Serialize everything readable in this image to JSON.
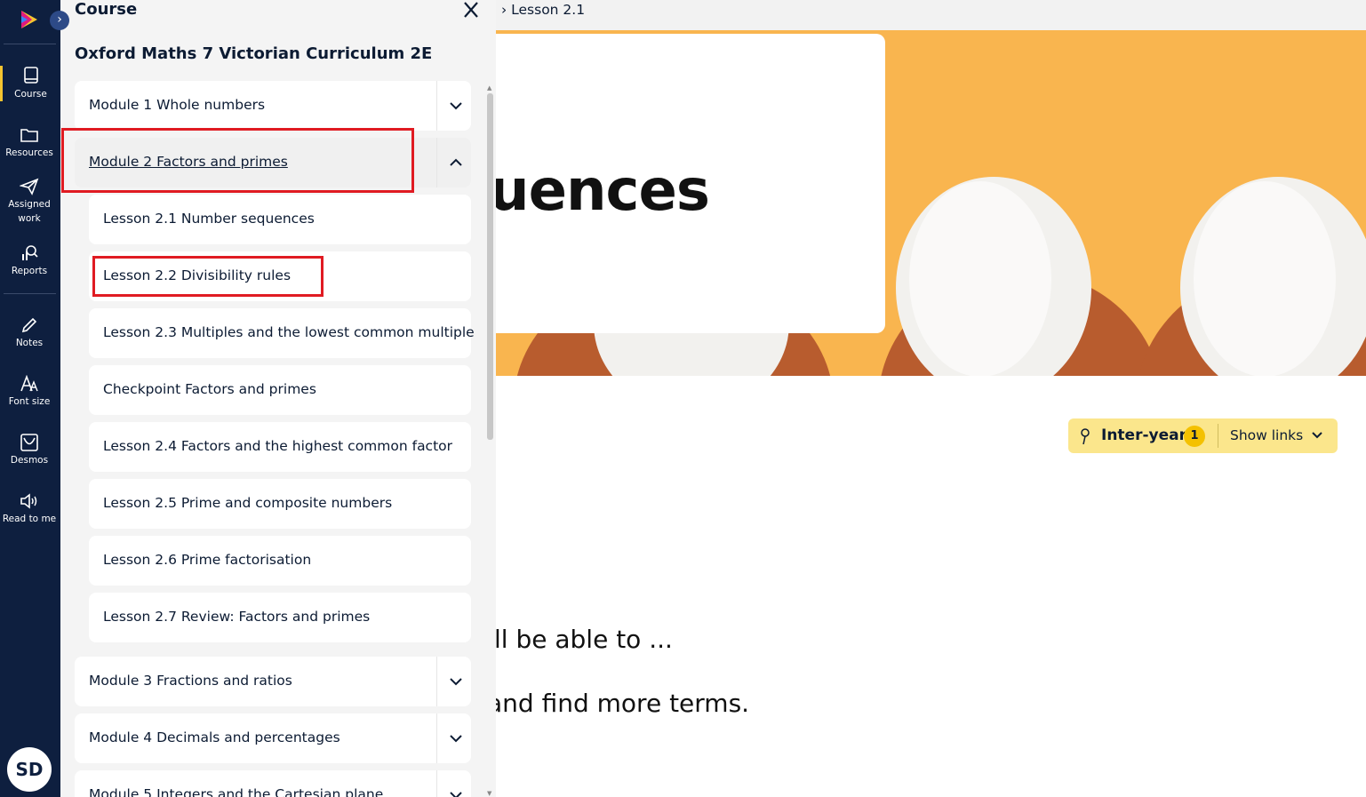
{
  "rail": {
    "items": [
      {
        "label": "Course",
        "icon": "book-icon"
      },
      {
        "label": "Resources",
        "icon": "folder-icon"
      },
      {
        "label": "Assigned",
        "label2": "work",
        "icon": "paper-plane-icon"
      },
      {
        "label": "Reports",
        "icon": "reports-icon"
      },
      {
        "label": "Notes",
        "icon": "pencil-icon"
      },
      {
        "label": "Font size",
        "icon": "font-size-icon"
      },
      {
        "label": "Desmos",
        "icon": "desmos-icon"
      },
      {
        "label": "Read to me",
        "icon": "speaker-icon"
      }
    ],
    "avatar": "SD"
  },
  "panel": {
    "title": "Course",
    "course_title": "Oxford Maths 7 Victorian Curriculum 2E",
    "modules": [
      {
        "label": "Module 1 Whole numbers"
      },
      {
        "label": "Module 2 Factors and primes"
      },
      {
        "label": "Module 3 Fractions and ratios"
      },
      {
        "label": "Module 4 Decimals and percentages"
      },
      {
        "label": "Module 5 Integers and the Cartesian plane"
      }
    ],
    "lessons": [
      {
        "label": "Lesson 2.1 Number sequences"
      },
      {
        "label": "Lesson 2.2 Divisibility rules"
      },
      {
        "label": "Lesson 2.3 Multiples and the lowest common multiple"
      },
      {
        "label": "Checkpoint Factors and primes"
      },
      {
        "label": "Lesson 2.4 Factors and the highest common factor"
      },
      {
        "label": "Lesson 2.5 Prime and composite numbers"
      },
      {
        "label": "Lesson 2.6 Prime factorisation"
      },
      {
        "label": "Lesson 2.7 Review: Factors and primes"
      }
    ]
  },
  "main": {
    "breadcrumb": "Lesson 2.1",
    "hero_title": "uences",
    "pill": {
      "label": "Inter-year",
      "count": "1",
      "show": "Show links"
    },
    "line1": "ll be able to ...",
    "line2": "and find more terms."
  },
  "colors": {
    "highlight": "#e01b22",
    "rail_bg": "#0e1f3f",
    "accent": "#f4c430",
    "hero_bg": "#f9b54f"
  }
}
